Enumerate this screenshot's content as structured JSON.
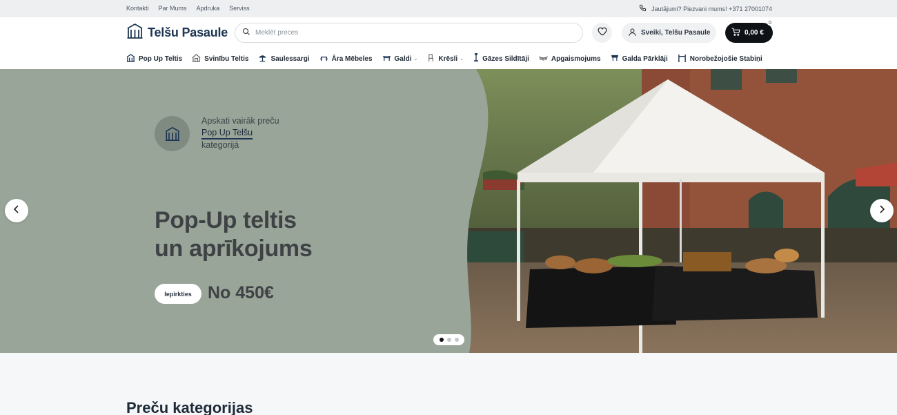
{
  "topbar": {
    "links": [
      "Kontakti",
      "Par Mums",
      "Apdruka",
      "Serviss"
    ],
    "contact_text": "Jautājumi? Piezvani mums! +371 27001074",
    "phone_icon": "phone-icon"
  },
  "header": {
    "logo_text": "Telšu Pasaule",
    "search_placeholder": "Meklēt preces",
    "account_label": "Sveiki, Telšu Pasaule",
    "cart_total": "0,00 €",
    "cart_count": "0"
  },
  "nav": [
    {
      "label": "Pop Up Teltis",
      "icon": "tent-icon",
      "dropdown": false
    },
    {
      "label": "Svinību Teltis",
      "icon": "party-tent-icon",
      "dropdown": false
    },
    {
      "label": "Saulessargi",
      "icon": "umbrella-icon",
      "dropdown": false
    },
    {
      "label": "Āra Mēbeles",
      "icon": "furniture-icon",
      "dropdown": false
    },
    {
      "label": "Galdi",
      "icon": "table-icon",
      "dropdown": true
    },
    {
      "label": "Krēsli",
      "icon": "chair-icon",
      "dropdown": true
    },
    {
      "label": "Gāzes Sildītāji",
      "icon": "heater-icon",
      "dropdown": false
    },
    {
      "label": "Apgaismojums",
      "icon": "lighting-icon",
      "dropdown": false
    },
    {
      "label": "Galda Pārklāji",
      "icon": "tablecloth-icon",
      "dropdown": false
    },
    {
      "label": "Norobežojošie Stabiņi",
      "icon": "barrier-post-icon",
      "dropdown": false
    }
  ],
  "hero": {
    "promo_line1": "Apskati vairāk preču",
    "promo_link": "Pop Up Telšu",
    "promo_line3": "kategorijā",
    "title_line1": "Pop-Up teltis",
    "title_line2": "un aprīkojums",
    "button_label": "Iepirkties",
    "price": "No 450€",
    "slides": 3,
    "active_slide": 1
  },
  "sections": {
    "categories_title": "Preču kategorijas"
  },
  "colors": {
    "brand": "#1c3553",
    "hero_green": "#98a598",
    "cart_bg": "#0e1217"
  }
}
